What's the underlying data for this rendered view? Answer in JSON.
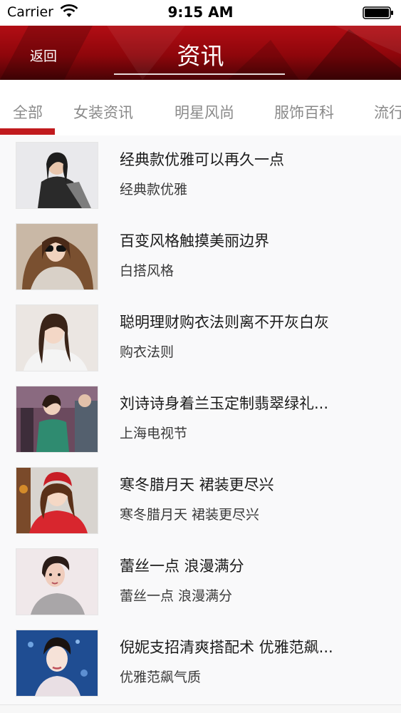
{
  "status_bar": {
    "carrier": "Carrier",
    "time": "9:15 AM"
  },
  "header": {
    "back_label": "返回",
    "title": "资讯",
    "brand_color": "#b20d14"
  },
  "tabs": [
    {
      "label": "全部",
      "active": true
    },
    {
      "label": "女装资讯",
      "active": false
    },
    {
      "label": "明星风尚",
      "active": false
    },
    {
      "label": "服饰百科",
      "active": false
    },
    {
      "label": "流行",
      "active": false
    }
  ],
  "articles": [
    {
      "title": "经典款优雅可以再久一点",
      "subtitle": "经典款优雅"
    },
    {
      "title": "百变风格触摸美丽边界",
      "subtitle": "白搭风格"
    },
    {
      "title": "聪明理财购衣法则离不开灰白灰",
      "subtitle": "购衣法则"
    },
    {
      "title": "刘诗诗身着兰玉定制翡翠绿礼...",
      "subtitle": "上海电视节"
    },
    {
      "title": "寒冬腊月天 裙装更尽兴",
      "subtitle": "寒冬腊月天 裙装更尽兴"
    },
    {
      "title": "蕾丝一点 浪漫满分",
      "subtitle": "蕾丝一点 浪漫满分"
    },
    {
      "title": "倪妮支招清爽搭配术 优雅范飙...",
      "subtitle": "优雅范飙气质"
    }
  ]
}
